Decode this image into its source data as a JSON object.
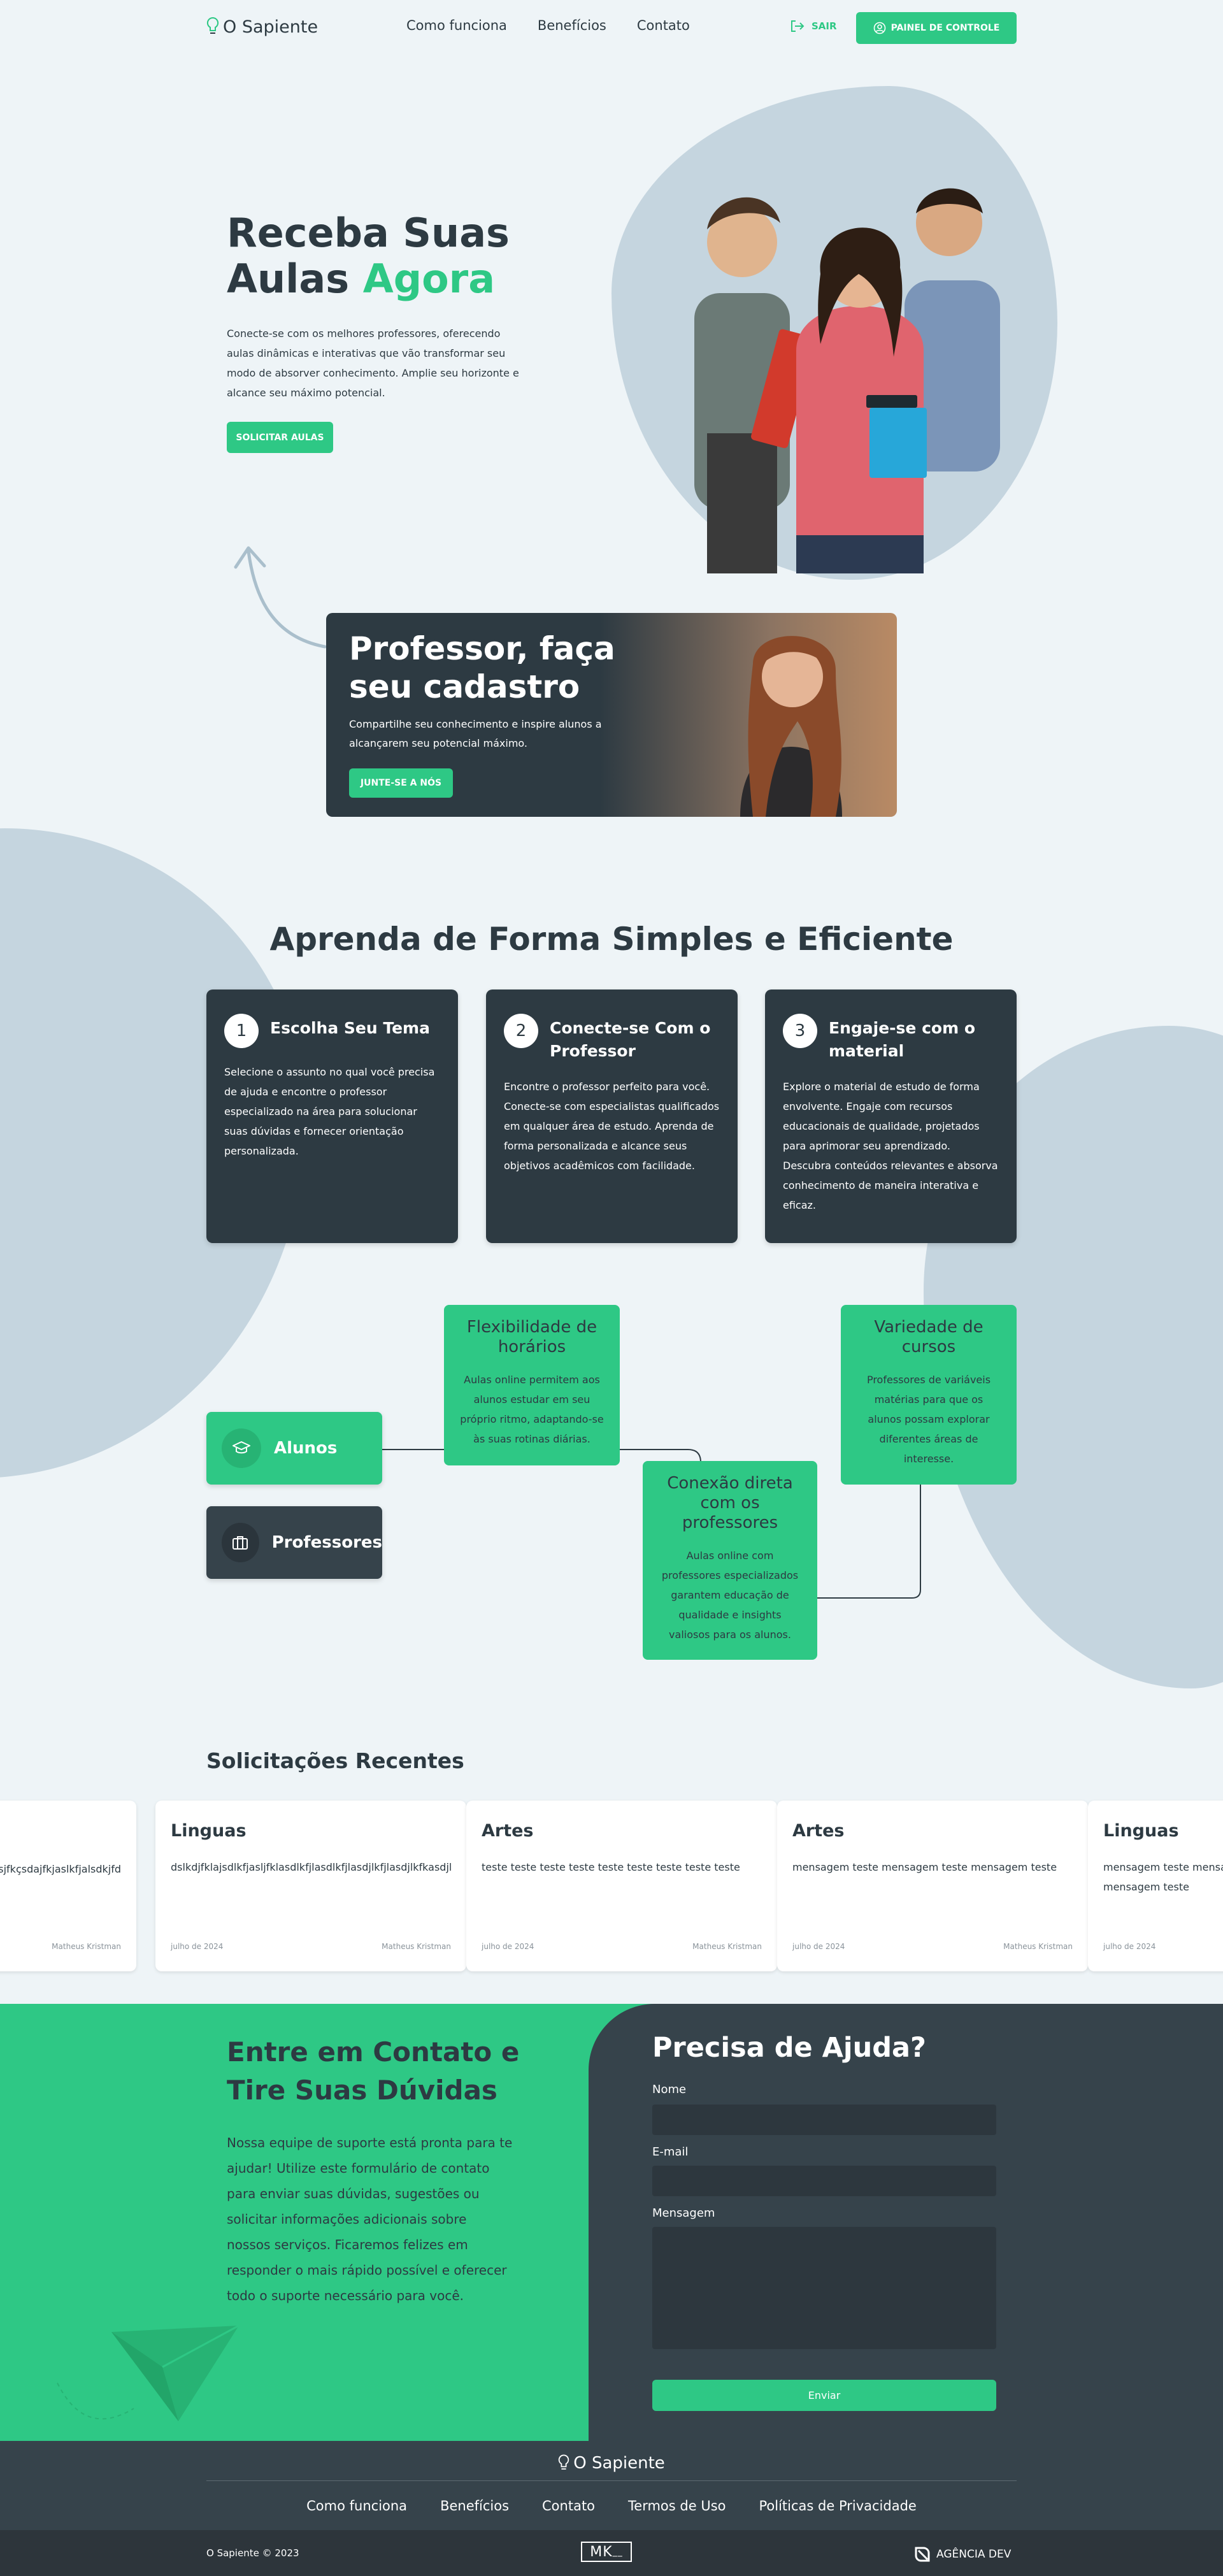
{
  "header": {
    "logo": "O Sapiente",
    "nav": [
      "Como funciona",
      "Benefícios",
      "Contato"
    ],
    "logout": "SAIR",
    "dashboard_button": "PAINEL DE CONTROLE"
  },
  "hero": {
    "title_line1": "Receba Suas",
    "title_line2_prefix": "Aulas",
    "title_line2_accent": "Agora",
    "text": "Conecte-se com os melhores professores, oferecendo aulas dinâmicas e interativas que vão transformar seu modo de absorver conhecimento. Amplie seu horizonte e alcance seu máximo potencial.",
    "button": "SOLICITAR AULAS"
  },
  "teacher": {
    "title_line1": "Professor, faça",
    "title_line2": "seu cadastro",
    "text": "Compartilhe seu conhecimento e inspire alunos a alcançarem seu potencial máximo.",
    "button": "JUNTE-SE A NÓS"
  },
  "how": {
    "title": "Aprenda de Forma Simples e Eficiente",
    "steps": [
      {
        "num": "1",
        "title": "Escolha Seu Tema",
        "text": "Selecione o assunto no qual você precisa de ajuda e encontre o professor especializado na área para solucionar suas dúvidas e fornecer orientação personalizada."
      },
      {
        "num": "2",
        "title": "Conecte-se Com o Professor",
        "text": "Encontre o professor perfeito para você. Conecte-se com especialistas qualificados em qualquer área de estudo. Aprenda de forma personalizada e alcance seus objetivos acadêmicos com facilidade."
      },
      {
        "num": "3",
        "title": "Engaje-se com o material",
        "text": "Explore o material de estudo de forma envolvente. Engaje com recursos educacionais de qualidade, projetados para aprimorar seu aprendizado. Descubra conteúdos relevantes e absorva conhecimento de maneira interativa e eficaz."
      }
    ]
  },
  "benefits": {
    "roles": [
      "Alunos",
      "Professores"
    ],
    "features": [
      {
        "title": "Flexibilidade de horários",
        "text": "Aulas online permitem aos alunos estudar em seu próprio ritmo, adaptando-se às suas rotinas diárias."
      },
      {
        "title": "Conexão direta com os professores",
        "text": "Aulas online com professores especializados garantem educação de qualidade e insights valiosos para os alunos."
      },
      {
        "title": "Variedade de cursos",
        "text": "Professores de variáveis matérias para que os alunos possam explorar diferentes áreas de interesse."
      }
    ]
  },
  "requests": {
    "title": "Solicitações Recentes",
    "items": [
      {
        "category": "",
        "message": "dsjfkçsdajfkjaslkfjalsdkjfd",
        "date": "",
        "author": "Matheus Kristman"
      },
      {
        "category": "Linguas",
        "message": "dslkdjfklajsdlkfjasljfklasdlkfjlasdlkfjlasdjlkfjlasdjlkfkasdjlkfjasdl",
        "date": "julho de 2024",
        "author": "Matheus Kristman"
      },
      {
        "category": "Artes",
        "message": "teste teste teste teste teste teste teste teste teste",
        "date": "julho de 2024",
        "author": "Matheus Kristman"
      },
      {
        "category": "Artes",
        "message": "mensagem teste mensagem teste mensagem teste",
        "date": "julho de 2024",
        "author": "Matheus Kristman"
      },
      {
        "category": "Linguas",
        "message": "mensagem teste mensagem teste mensagem teste mensagem teste",
        "date": "julho de 2024",
        "author": ""
      }
    ]
  },
  "contact": {
    "title_line1": "Entre em Contato e",
    "title_line2": "Tire Suas Dúvidas",
    "text": "Nossa equipe de suporte está pronta para te ajudar! Utilize este formulário de contato para enviar suas dúvidas, sugestões ou solicitar informações adicionais sobre nossos serviços. Ficaremos felizes em responder o mais rápido possível e oferecer todo o suporte necessário para você.",
    "form_title": "Precisa de Ajuda?",
    "name_label": "Nome",
    "email_label": "E-mail",
    "message_label": "Mensagem",
    "submit": "Enviar"
  },
  "footer": {
    "logo": "O Sapiente",
    "links": [
      "Como funciona",
      "Benefícios",
      "Contato",
      "Termos de Uso",
      "Políticas de Privacidade"
    ],
    "copyright": "O Sapiente © 2023",
    "mk_logo": "MK",
    "agency": "AGÊNCIA DEV"
  },
  "colors": {
    "accent": "#2ec885",
    "dark": "#2d3a42",
    "background": "#eef4f7",
    "blob": "#c5d5df"
  }
}
